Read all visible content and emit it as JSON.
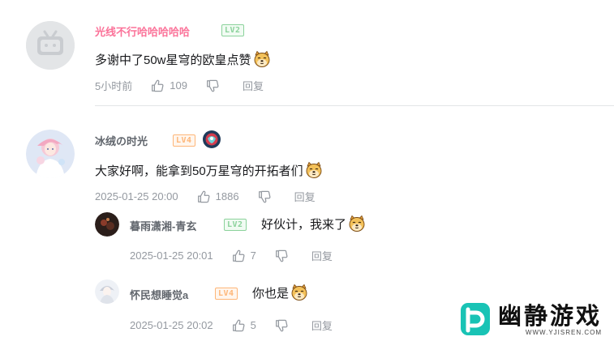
{
  "comments": [
    {
      "username": "光线不行哈哈哈哈哈",
      "username_color": "#fb7299",
      "level": "LV2",
      "text": "多谢中了50w星穹的欧皇点赞",
      "time": "5小时前",
      "likes": "109",
      "reply_label": "回复"
    },
    {
      "username": "冰绒の时光",
      "username_color": "#61666d",
      "level": "LV4",
      "text": "大家好啊，能拿到50万星穹的开拓者们",
      "time": "2025-01-25 20:00",
      "likes": "1886",
      "reply_label": "回复",
      "replies": [
        {
          "username": "暮雨潇湘-青玄",
          "level": "LV2",
          "text": "好伙计，我来了",
          "time": "2025-01-25 20:01",
          "likes": "7",
          "reply_label": "回复"
        },
        {
          "username": "怀民想睡觉a",
          "level": "LV4",
          "text": "你也是",
          "time": "2025-01-25 20:02",
          "likes": "5",
          "reply_label": "回复"
        }
      ]
    }
  ],
  "watermark": {
    "title": "幽静游戏",
    "url": "WWW.YJISREN.COM"
  },
  "colors": {
    "pink": "#fb7299",
    "lv2": "#8bd29b",
    "lv4": "#feb678",
    "meta": "#9499a0",
    "brand_teal": "#19c3b5"
  }
}
